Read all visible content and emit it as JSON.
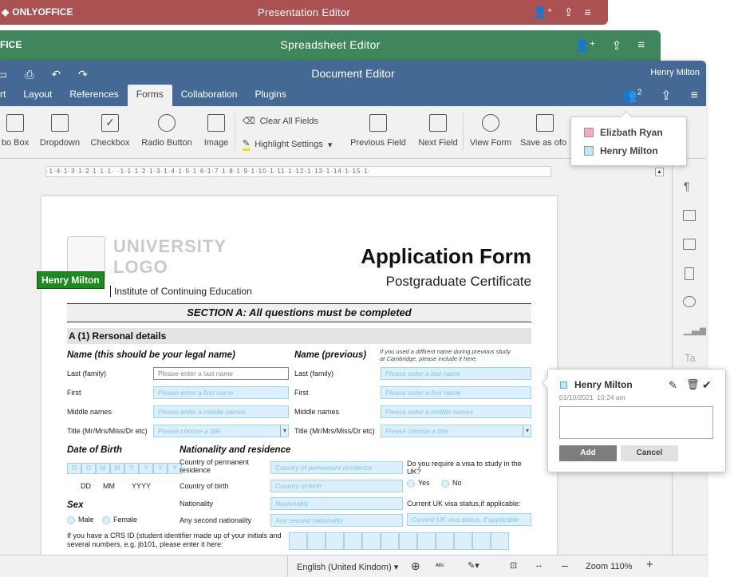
{
  "windows": {
    "presentation": {
      "logo": "ONLYOFFICE",
      "title": "Presentation Editor"
    },
    "spreadsheet": {
      "logo": "FICE",
      "title": "Spreadsheet Editor"
    },
    "document": {
      "title": "Document Editor",
      "user": "Henry Milton",
      "users_count": "2"
    }
  },
  "tabs": [
    "rt",
    "Layout",
    "References",
    "Forms",
    "Collaboration",
    "Plugins"
  ],
  "active_tab": "Forms",
  "toolbar": {
    "combo_box": "bo Box",
    "dropdown": "Dropdown",
    "checkbox": "Checkbox",
    "radio_button": "Radio Button",
    "image": "Image",
    "clear_fields": "Clear All Fields",
    "highlight": "Highlight Settings",
    "previous_field": "Previous Field",
    "next_field": "Next Field",
    "view_form": "View Form",
    "save_as": "Save as ofo"
  },
  "ruler": "·1·4·1·3·1·2·1·1·1·  ·1·1·1·2·1·3·1·4·1·5·1·6·1·7·1·8·1·9·1·10·1·11·1·12·1·13·1·14·1·15·1·",
  "users_popup": [
    {
      "name": "Elizbath Ryan",
      "color": "#f7a8c3"
    },
    {
      "name": "Henry Milton",
      "color": "#bfe8f7"
    }
  ],
  "comment": {
    "author": "Henry Milton",
    "date": "01/10/2021",
    "time": "10:24 am",
    "add": "Add",
    "cancel": "Cancel"
  },
  "tag": "Henry Milton",
  "form": {
    "logo_line1": "UNIVERSITY",
    "logo_line2": "LOGO",
    "institute": "Institute of Continuing Education",
    "title": "Application Form",
    "subtitle": "Postgraduate Certificate",
    "section": "SECTION A: All questions must be completed",
    "personal": "A (1) Rersonal details",
    "name_legal": "Name (this should be your legal name)",
    "name_prev": "Name (previous)",
    "prev_note": "If you used a diffirent name during previous study at Cambridge, please include it here.",
    "last": "Last (family)",
    "first": "First",
    "middle": "Middle names",
    "title_lbl": "Title (Mr/Mrs/Miss/Dr etc)",
    "ph_last": "Please enter a last name",
    "ph_first": "Please enter a first name",
    "ph_middle": "Please enter a middle names",
    "ph_title": "Please choose a title",
    "dob": "Date of Birth",
    "date_cells": [
      "D",
      "D",
      "M",
      "M",
      "Y",
      "Y",
      "Y",
      "Y"
    ],
    "dd": "DD",
    "mm": "MM",
    "yyyy": "YYYY",
    "nat_res": "Nationality and residence",
    "perm_res": "Country of permanent residence",
    "ph_perm": "Country of permanent residence",
    "birth": "Country of birth",
    "ph_birth": "Country of birth",
    "nationality": "Nationality",
    "ph_nat": "Nacionality",
    "second_nat": "Any second nationality",
    "ph_second": "Any second nationality",
    "visa_q": "Do you require a visa to study in the UK?",
    "yes": "Yes",
    "no": "No",
    "visa_status": "Current UK visa status,if applicable:",
    "ph_visa": "Current UK visa status, if applicable",
    "sex": "Sex",
    "male": "Male",
    "female": "Female",
    "crs": "If you have a CRS ID (student identifier made up of your initials and several numbers, e.g. jb101, please enter it here:"
  },
  "status": {
    "language": "English (United Kindom)",
    "zoom": "Zoom 110%"
  }
}
